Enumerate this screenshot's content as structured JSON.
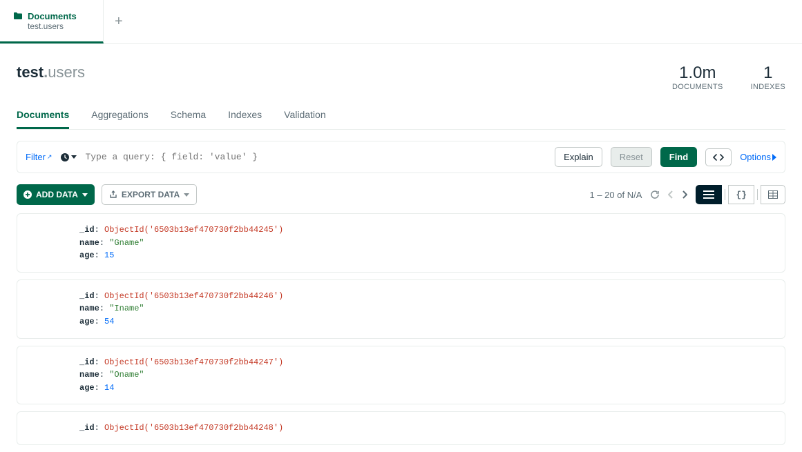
{
  "tab": {
    "title": "Documents",
    "subtitle": "test.users"
  },
  "namespace": {
    "db": "test",
    "coll": "users"
  },
  "stats": {
    "documents": {
      "value": "1.0m",
      "label": "DOCUMENTS"
    },
    "indexes": {
      "value": "1",
      "label": "INDEXES"
    }
  },
  "subtabs": [
    "Documents",
    "Aggregations",
    "Schema",
    "Indexes",
    "Validation"
  ],
  "query": {
    "filter_label": "Filter",
    "placeholder": "Type a query: { field: 'value' }",
    "explain": "Explain",
    "reset": "Reset",
    "find": "Find",
    "options": "Options"
  },
  "toolbar": {
    "add_data": "ADD DATA",
    "export": "EXPORT DATA",
    "pagination": "1 – 20 of N/A"
  },
  "documents": [
    {
      "_id": "ObjectId('6503b13ef470730f2bb44245')",
      "name": "\"Gname\"",
      "age": "15"
    },
    {
      "_id": "ObjectId('6503b13ef470730f2bb44246')",
      "name": "\"Iname\"",
      "age": "54"
    },
    {
      "_id": "ObjectId('6503b13ef470730f2bb44247')",
      "name": "\"Oname\"",
      "age": "14"
    },
    {
      "_id": "ObjectId('6503b13ef470730f2bb44248')"
    }
  ]
}
